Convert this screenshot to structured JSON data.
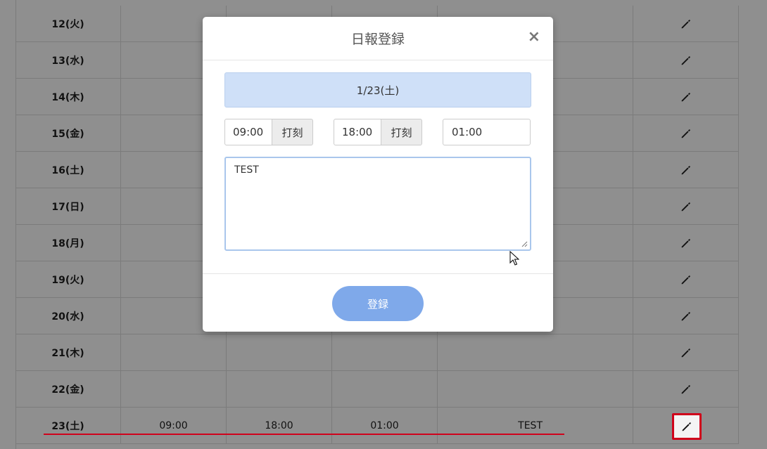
{
  "table": {
    "rows": [
      {
        "day": "12(火)",
        "start": "",
        "end": "",
        "break": "",
        "memo": ""
      },
      {
        "day": "13(水)",
        "start": "",
        "end": "",
        "break": "",
        "memo": ""
      },
      {
        "day": "14(木)",
        "start": "",
        "end": "",
        "break": "",
        "memo": ""
      },
      {
        "day": "15(金)",
        "start": "",
        "end": "",
        "break": "",
        "memo": ""
      },
      {
        "day": "16(土)",
        "start": "",
        "end": "",
        "break": "",
        "memo": ""
      },
      {
        "day": "17(日)",
        "start": "",
        "end": "",
        "break": "",
        "memo": ""
      },
      {
        "day": "18(月)",
        "start": "",
        "end": "",
        "break": "",
        "memo": ""
      },
      {
        "day": "19(火)",
        "start": "",
        "end": "",
        "break": "",
        "memo": ""
      },
      {
        "day": "20(水)",
        "start": "",
        "end": "",
        "break": "",
        "memo": ""
      },
      {
        "day": "21(木)",
        "start": "",
        "end": "",
        "break": "",
        "memo": ""
      },
      {
        "day": "22(金)",
        "start": "",
        "end": "",
        "break": "",
        "memo": ""
      },
      {
        "day": "23(土)",
        "start": "09:00",
        "end": "18:00",
        "break": "01:00",
        "memo": "TEST"
      }
    ],
    "edit_icon": "pencil-icon"
  },
  "modal": {
    "title": "日報登録",
    "close_label": "×",
    "date": "1/23(土)",
    "start_time": "09:00",
    "end_time": "18:00",
    "stamp_label": "打刻",
    "break_time": "01:00",
    "memo": "TEST",
    "submit_label": "登録"
  },
  "colors": {
    "highlight": "#d0021b",
    "primary_button": "#7fa9ea",
    "date_banner": "#cfe0f8"
  }
}
